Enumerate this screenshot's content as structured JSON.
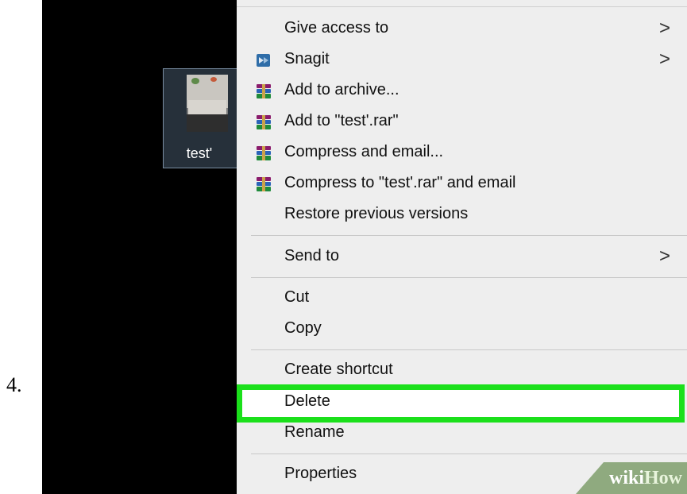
{
  "step_number": "4.",
  "file": {
    "name": "test'"
  },
  "context_menu": {
    "items": [
      {
        "label": "Give access to",
        "icon": "",
        "submenu": true
      },
      {
        "label": "Snagit",
        "icon": "snagit-icon",
        "submenu": true
      },
      {
        "label": "Add to archive...",
        "icon": "winrar-icon",
        "submenu": false
      },
      {
        "label": "Add to \"test'.rar\"",
        "icon": "winrar-icon",
        "submenu": false
      },
      {
        "label": "Compress and email...",
        "icon": "winrar-icon",
        "submenu": false
      },
      {
        "label": "Compress to \"test'.rar\" and email",
        "icon": "winrar-icon",
        "submenu": false
      },
      {
        "label": "Restore previous versions",
        "icon": "",
        "submenu": false
      },
      {
        "label": "Send to",
        "icon": "",
        "submenu": true
      },
      {
        "label": "Cut",
        "icon": "",
        "submenu": false
      },
      {
        "label": "Copy",
        "icon": "",
        "submenu": false
      },
      {
        "label": "Create shortcut",
        "icon": "",
        "submenu": false
      },
      {
        "label": "Delete",
        "icon": "",
        "submenu": false,
        "highlighted": true
      },
      {
        "label": "Rename",
        "icon": "",
        "submenu": false
      },
      {
        "label": "Properties",
        "icon": "",
        "submenu": false
      }
    ],
    "submenu_arrow": ">",
    "highlight_color": "#1be01b"
  },
  "watermark": {
    "part1": "wiki",
    "part2": "How"
  }
}
